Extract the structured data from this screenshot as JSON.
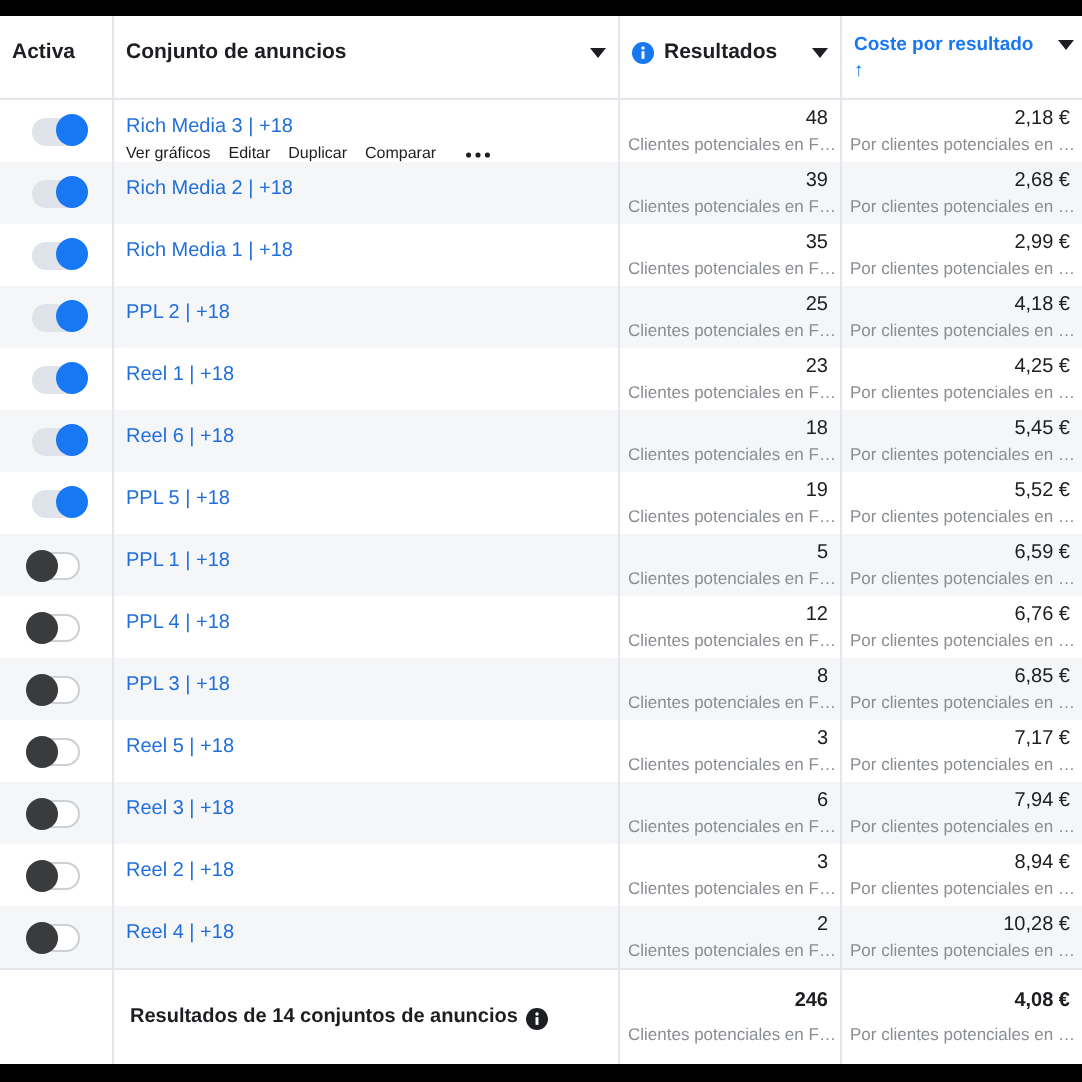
{
  "columns": [
    {
      "label": "Activa",
      "kind": "plain"
    },
    {
      "label": "Conjunto de anuncios",
      "kind": "dropdown"
    },
    {
      "label": "Resultados",
      "kind": "info"
    },
    {
      "label": "Coste por resultado",
      "kind": "sorted",
      "sort_arrow": "↑"
    }
  ],
  "rows": [
    {
      "name": "Rich Media 3 | +18",
      "on": true,
      "results": "48",
      "results_sub": "Clientes potenciales en F…",
      "cost": "2,18 €",
      "cost_sub": "Por clientes potenciales en …",
      "actions": [
        "Ver gráficos",
        "Editar",
        "Duplicar",
        "Comparar"
      ]
    },
    {
      "name": "Rich Media 2 | +18",
      "on": true,
      "results": "39",
      "results_sub": "Clientes potenciales en F…",
      "cost": "2,68 €",
      "cost_sub": "Por clientes potenciales en …"
    },
    {
      "name": "Rich Media 1 | +18",
      "on": true,
      "results": "35",
      "results_sub": "Clientes potenciales en F…",
      "cost": "2,99 €",
      "cost_sub": "Por clientes potenciales en …"
    },
    {
      "name": "PPL 2 | +18",
      "on": true,
      "results": "25",
      "results_sub": "Clientes potenciales en F…",
      "cost": "4,18 €",
      "cost_sub": "Por clientes potenciales en …"
    },
    {
      "name": "Reel 1 | +18",
      "on": true,
      "results": "23",
      "results_sub": "Clientes potenciales en F…",
      "cost": "4,25 €",
      "cost_sub": "Por clientes potenciales en …"
    },
    {
      "name": "Reel 6 | +18",
      "on": true,
      "results": "18",
      "results_sub": "Clientes potenciales en F…",
      "cost": "5,45 €",
      "cost_sub": "Por clientes potenciales en …"
    },
    {
      "name": "PPL 5 | +18",
      "on": true,
      "results": "19",
      "results_sub": "Clientes potenciales en F…",
      "cost": "5,52 €",
      "cost_sub": "Por clientes potenciales en …"
    },
    {
      "name": "PPL 1 | +18",
      "on": false,
      "results": "5",
      "results_sub": "Clientes potenciales en F…",
      "cost": "6,59 €",
      "cost_sub": "Por clientes potenciales en …"
    },
    {
      "name": "PPL 4 | +18",
      "on": false,
      "results": "12",
      "results_sub": "Clientes potenciales en F…",
      "cost": "6,76 €",
      "cost_sub": "Por clientes potenciales en …"
    },
    {
      "name": "PPL 3 | +18",
      "on": false,
      "results": "8",
      "results_sub": "Clientes potenciales en F…",
      "cost": "6,85 €",
      "cost_sub": "Por clientes potenciales en …"
    },
    {
      "name": "Reel 5 | +18",
      "on": false,
      "results": "3",
      "results_sub": "Clientes potenciales en F…",
      "cost": "7,17 €",
      "cost_sub": "Por clientes potenciales en …"
    },
    {
      "name": "Reel 3 | +18",
      "on": false,
      "results": "6",
      "results_sub": "Clientes potenciales en F…",
      "cost": "7,94 €",
      "cost_sub": "Por clientes potenciales en …"
    },
    {
      "name": "Reel 2 | +18",
      "on": false,
      "results": "3",
      "results_sub": "Clientes potenciales en F…",
      "cost": "8,94 €",
      "cost_sub": "Por clientes potenciales en …"
    },
    {
      "name": "Reel 4 | +18",
      "on": false,
      "results": "2",
      "results_sub": "Clientes potenciales en F…",
      "cost": "10,28 €",
      "cost_sub": "Por clientes potenciales en …"
    }
  ],
  "summary": {
    "label": "Resultados de 14 conjuntos de anuncios",
    "results": "246",
    "results_sub": "Clientes potenciales en F…",
    "cost": "4,08 €",
    "cost_sub": "Por clientes potenciales en …"
  }
}
